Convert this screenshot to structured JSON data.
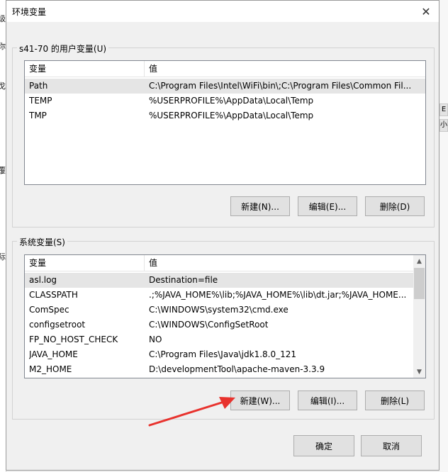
{
  "background_window": {
    "left_fragments": [
      "级",
      "你",
      "戈",
      "覆",
      "际"
    ],
    "right_fragments": [
      "E",
      "小"
    ]
  },
  "dialog": {
    "title": "环境变量",
    "close_glyph": "✕"
  },
  "user_vars": {
    "group_label": "s41-70 的用户变量(U)",
    "columns": [
      "变量",
      "值"
    ],
    "rows": [
      {
        "name": "Path",
        "value": "C:\\Program Files\\Intel\\WiFi\\bin\\;C:\\Program Files\\Common Fil...",
        "selected": true
      },
      {
        "name": "TEMP",
        "value": "%USERPROFILE%\\AppData\\Local\\Temp",
        "selected": false
      },
      {
        "name": "TMP",
        "value": "%USERPROFILE%\\AppData\\Local\\Temp",
        "selected": false
      }
    ],
    "buttons": {
      "new": "新建(N)...",
      "edit": "编辑(E)...",
      "delete": "删除(D)"
    }
  },
  "system_vars": {
    "group_label": "系统变量(S)",
    "columns": [
      "变量",
      "值"
    ],
    "rows": [
      {
        "name": "asl.log",
        "value": "Destination=file",
        "selected": true
      },
      {
        "name": "CLASSPATH",
        "value": ".;%JAVA_HOME%\\lib;%JAVA_HOME%\\lib\\dt.jar;%JAVA_HOME...",
        "selected": false
      },
      {
        "name": "ComSpec",
        "value": "C:\\WINDOWS\\system32\\cmd.exe",
        "selected": false
      },
      {
        "name": "configsetroot",
        "value": "C:\\WINDOWS\\ConfigSetRoot",
        "selected": false
      },
      {
        "name": "FP_NO_HOST_CHECK",
        "value": "NO",
        "selected": false
      },
      {
        "name": "JAVA_HOME",
        "value": "C:\\Program Files\\Java\\jdk1.8.0_121",
        "selected": false
      },
      {
        "name": "M2_HOME",
        "value": "D:\\developmentTool\\apache-maven-3.3.9",
        "selected": false
      }
    ],
    "buttons": {
      "new": "新建(W)...",
      "edit": "编辑(I)...",
      "delete": "删除(L)"
    }
  },
  "footer": {
    "ok": "确定",
    "cancel": "取消"
  },
  "colors": {
    "annotation_arrow": "#e8322d",
    "selected_row": "#e5e5e5"
  }
}
